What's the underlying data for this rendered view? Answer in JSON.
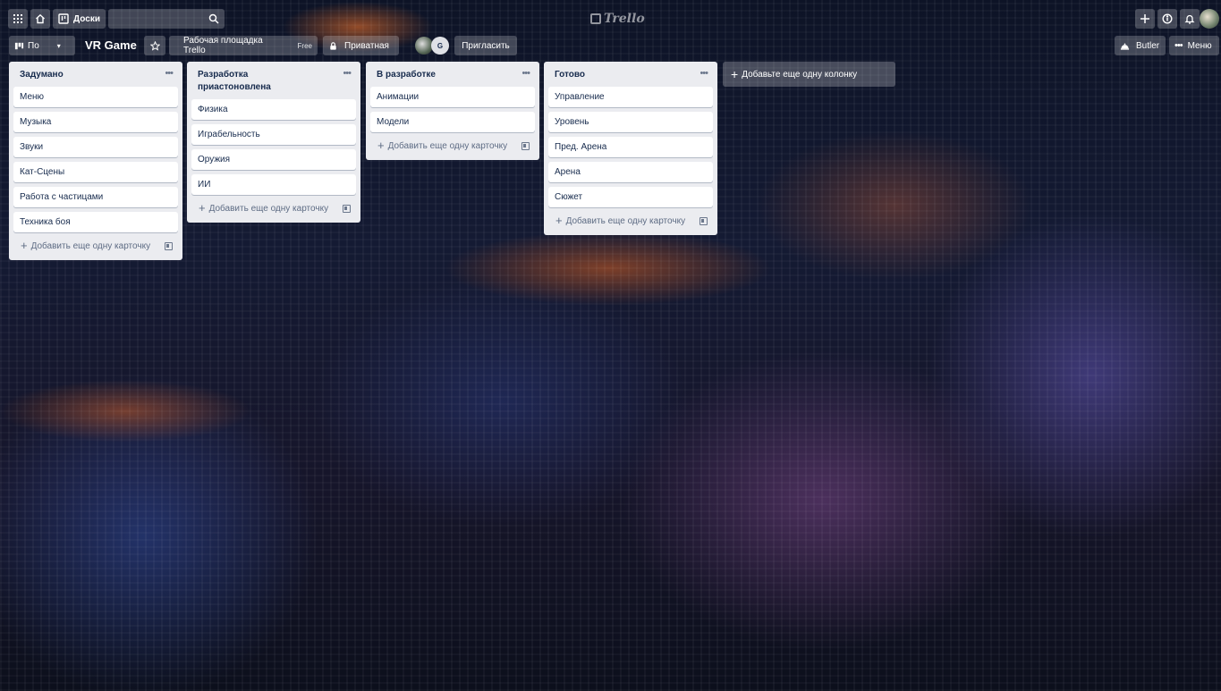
{
  "header": {
    "boards_label": "Доски",
    "search_placeholder": "",
    "logo_text": "Trello"
  },
  "board": {
    "view_label": "По",
    "title": "VR Game",
    "workspace_label": "Рабочая площадка Trello",
    "workspace_badge": "Free",
    "visibility_label": "Приватная",
    "member_initial": "G",
    "invite_label": "Пригласить",
    "butler_label": "Butler",
    "menu_label": "Меню"
  },
  "lists": [
    {
      "title": "Задумано",
      "cards": [
        "Меню",
        "Музыка",
        "Звуки",
        "Кат-Сцены",
        "Работа с частицами",
        "Техника боя"
      ],
      "add_card_label": "Добавить еще одну карточку"
    },
    {
      "title": "Разработка приастоновлена",
      "cards": [
        "Физика",
        "Играбельность",
        "Оружия",
        "ИИ"
      ],
      "add_card_label": "Добавить еще одну карточку"
    },
    {
      "title": "В разработке",
      "cards": [
        "Анимации",
        "Модели"
      ],
      "add_card_label": "Добавить еще одну карточку"
    },
    {
      "title": "Готово",
      "cards": [
        "Управление",
        "Уровень",
        "Пред. Арена",
        "Арена",
        "Сюжет"
      ],
      "add_card_label": "Добавить еще одну карточку"
    }
  ],
  "add_list_label": "Добавьте еще одну колонку"
}
